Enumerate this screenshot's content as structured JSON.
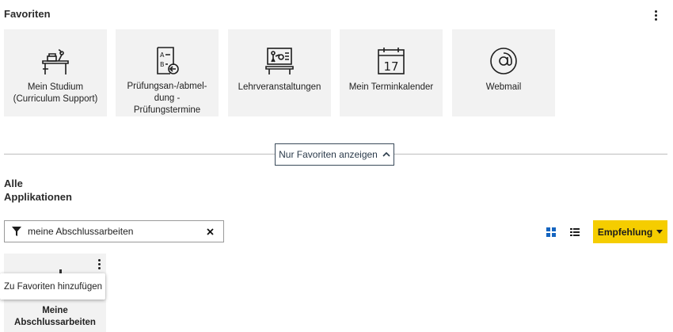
{
  "favorites": {
    "title": "Favoriten",
    "tiles": [
      {
        "label": "Mein Studium\n(Curriculum Support)",
        "icon": "student-desk-icon"
      },
      {
        "label": "Prüfungsan-/abmel-\ndung -\nPrüfungstermine",
        "icon": "exam-registration-icon"
      },
      {
        "label": "Lehrveranstaltungen",
        "icon": "presentation-board-icon"
      },
      {
        "label": "Mein Terminkalender",
        "icon": "calendar-icon",
        "calendar_day": "17"
      },
      {
        "label": "Webmail",
        "icon": "at-sign-icon"
      }
    ],
    "toggle_label": "Nur Favoriten anzeigen"
  },
  "all_apps": {
    "title": "Alle\nApplikationen",
    "filter": {
      "value": "meine Abschlussarbeiten",
      "placeholder": ""
    },
    "sort_label": "Empfehlung",
    "active_view": "grid",
    "accent_color": "#f5cd00",
    "view_icon_active_color": "#1565c0",
    "results": [
      {
        "label": "Meine\nAbschlussarbeiten"
      }
    ],
    "context_menu": {
      "item": "Zu Favoriten hinzufügen"
    }
  }
}
